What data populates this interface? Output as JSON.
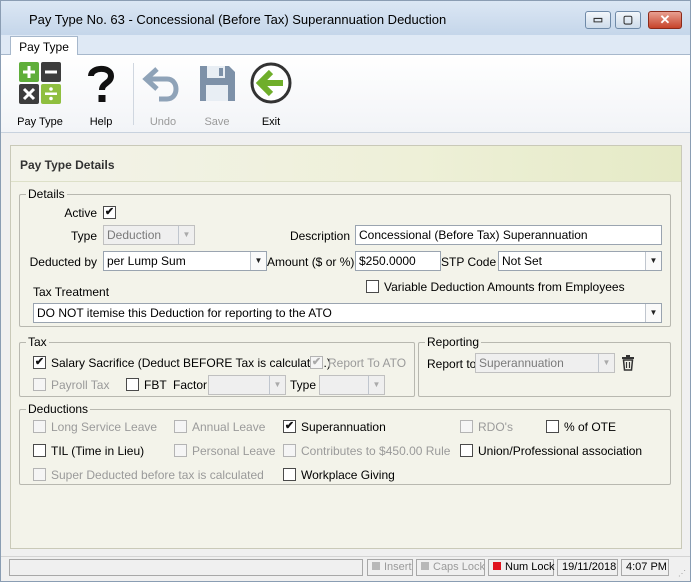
{
  "window": {
    "title": "Pay Type No. 63 - Concessional (Before Tax) Superannuation Deduction",
    "controls": {
      "minimize": "▭",
      "maximize": "▢",
      "close": "✕"
    }
  },
  "tabs": [
    {
      "label": "Pay Type"
    }
  ],
  "toolbar": {
    "pay_type": {
      "label": "Pay Type",
      "icon": "calculator-icon"
    },
    "help": {
      "label": "Help",
      "icon": "question-mark-icon"
    },
    "undo": {
      "label": "Undo",
      "icon": "undo-arrow-icon"
    },
    "save": {
      "label": "Save",
      "icon": "floppy-disk-icon"
    },
    "exit": {
      "label": "Exit",
      "icon": "exit-arrow-icon"
    }
  },
  "section_title": "Pay Type Details",
  "details": {
    "legend": "Details",
    "active_label": "Active",
    "active_checked": true,
    "type_label": "Type",
    "type_value": "Deduction",
    "description_label": "Description",
    "description_value": "Concessional (Before Tax) Superannuation",
    "deducted_by_label": "Deducted by",
    "deducted_by_value": "per Lump Sum",
    "amount_label": "Amount ($ or %)",
    "amount_value": "$250.0000",
    "stp_code_label": "STP Code",
    "stp_code_value": "Not Set",
    "tax_treatment_label": "Tax Treatment",
    "variable_label": "Variable Deduction Amounts from Employees",
    "variable_checked": false,
    "tax_treatment_value": "DO NOT itemise this Deduction for reporting to the ATO"
  },
  "tax": {
    "legend": "Tax",
    "salary_sacrifice_label": "Salary Sacrifice (Deduct BEFORE Tax is calculated.)",
    "salary_sacrifice_checked": true,
    "report_to_ato_label": "Report To ATO",
    "report_to_ato_checked": true,
    "payroll_tax_label": "Payroll Tax",
    "fbt_label": "FBT",
    "factor_label": "Factor",
    "factor_value": "",
    "type_label": "Type",
    "type_value": ""
  },
  "reporting": {
    "legend": "Reporting",
    "report_to_label": "Report to",
    "report_to_value": "Superannuation",
    "delete_icon": "trash-icon"
  },
  "deductions": {
    "legend": "Deductions",
    "items": [
      {
        "label": "Long Service Leave",
        "checked": false,
        "enabled": false
      },
      {
        "label": "Annual Leave",
        "checked": false,
        "enabled": false
      },
      {
        "label": "Superannuation",
        "checked": true,
        "enabled": true
      },
      {
        "label": "RDO's",
        "checked": false,
        "enabled": false
      },
      {
        "label": "% of OTE",
        "checked": false,
        "enabled": true
      },
      {
        "label": "TIL (Time in Lieu)",
        "checked": false,
        "enabled": true
      },
      {
        "label": "Personal Leave",
        "checked": false,
        "enabled": false
      },
      {
        "label": "Contributes to $450.00 Rule",
        "checked": false,
        "enabled": false
      },
      {
        "label": "Union/Professional association",
        "checked": false,
        "enabled": true
      },
      {
        "label": "Super Deducted before tax is calculated",
        "checked": false,
        "enabled": false
      },
      {
        "label": "Workplace Giving",
        "checked": false,
        "enabled": true
      }
    ]
  },
  "statusbar": {
    "insert": "Insert",
    "caps_lock": "Caps Lock",
    "num_lock": "Num Lock",
    "date": "19/11/2018",
    "time": "4:07 PM",
    "colors": {
      "off": "#b8b8b8",
      "on": "#e0141e"
    }
  }
}
